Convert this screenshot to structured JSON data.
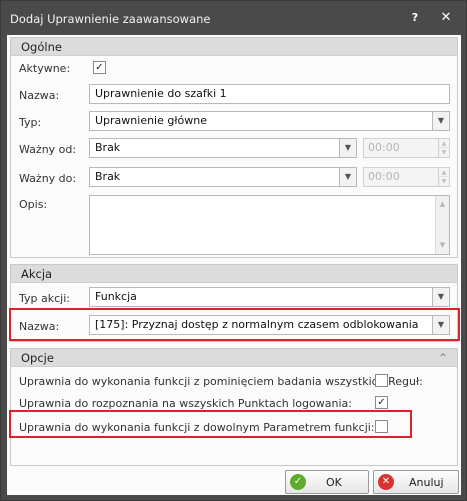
{
  "window": {
    "title": "Dodaj Uprawnienie zaawansowane",
    "help_glyph": "?",
    "close_glyph": "✕"
  },
  "general": {
    "header": "Ogólne",
    "active_label": "Aktywne:",
    "active_checked": true,
    "name_label": "Nazwa:",
    "name_value": "Uprawnienie do szafki 1",
    "type_label": "Typ:",
    "type_value": "Uprawnienie główne",
    "valid_from_label": "Ważny od:",
    "valid_from_value": "Brak",
    "valid_from_time": "00:00",
    "valid_to_label": "Ważny do:",
    "valid_to_value": "Brak",
    "valid_to_time": "00:00",
    "description_label": "Opis:",
    "description_value": ""
  },
  "action": {
    "header": "Akcja",
    "action_type_label": "Typ akcji:",
    "action_type_value": "Funkcja",
    "name_label": "Nazwa:",
    "name_value": "[175]: Przyznaj dostęp z normalnym czasem odblokowania"
  },
  "options": {
    "header": "Opcje",
    "collapse_glyph": "^",
    "items": [
      {
        "label": "Uprawnia do wykonania funkcji z pominięciem badania wszystkich Reguł:",
        "checked": false
      },
      {
        "label": "Uprawnia do rozpoznania na wszyskich Punktach logowania:",
        "checked": true
      },
      {
        "label": "Uprawnia do wykonania funkcji z dowolnym Parametrem funkcji:",
        "checked": false
      }
    ]
  },
  "buttons": {
    "ok": "OK",
    "cancel": "Anuluj"
  },
  "icons": {
    "ok": "check-circle-icon",
    "cancel": "x-circle-icon"
  },
  "colors": {
    "titlebar": "#4a4a4a",
    "highlight": "#e0202a",
    "ok_icon": "#5cab2c",
    "cancel_icon": "#d9322f"
  }
}
